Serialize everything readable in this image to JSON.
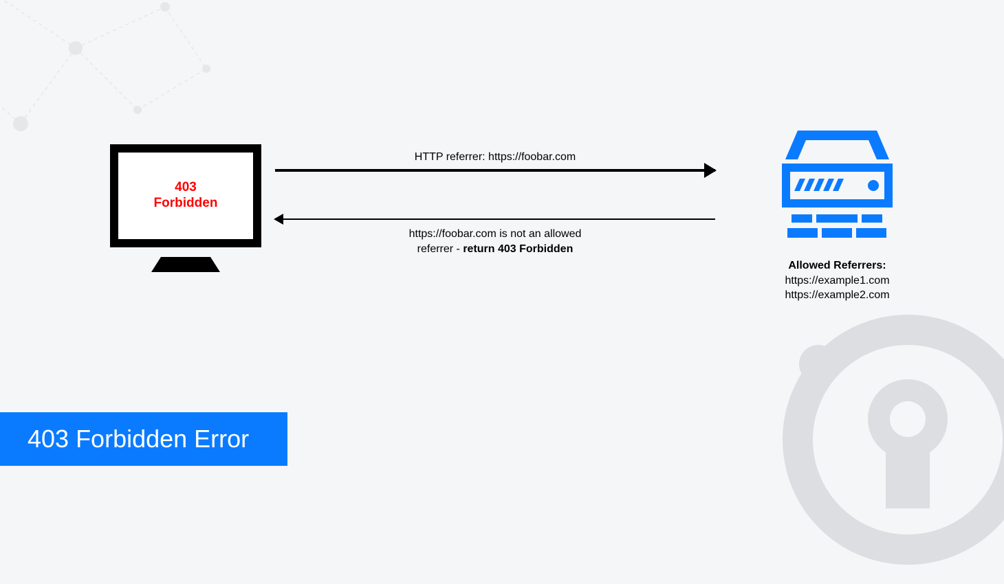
{
  "monitor": {
    "line1": "403",
    "line2": "Forbidden"
  },
  "request": {
    "label": "HTTP referrer: https://foobar.com"
  },
  "response": {
    "line1": "https://foobar.com is not an allowed",
    "line2_pre": "referrer - ",
    "line2_bold": "return 403 Forbidden"
  },
  "server": {
    "heading": "Allowed Referrers:",
    "items": [
      "https://example1.com",
      "https://example2.com"
    ]
  },
  "title": "403 Forbidden Error",
  "colors": {
    "accent": "#0a7bff",
    "error": "#ff0000"
  }
}
